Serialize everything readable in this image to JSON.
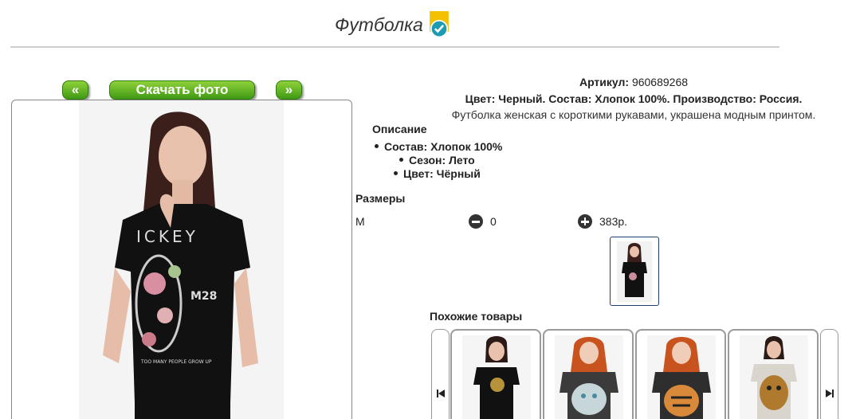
{
  "product": {
    "title": "Футболка",
    "article_label": "Артикул:",
    "article_value": "960689268",
    "meta_line": "Цвет: Черный. Состав: Хлопок 100%. Производство: Россия.",
    "short_description": "Футболка женская с короткими рукавами, украшена модным принтом."
  },
  "photo_nav": {
    "prev_label": "«",
    "download_label": "Скачать фото",
    "next_label": "»"
  },
  "description": {
    "heading": "Описание",
    "items": [
      "Состав: Хлопок 100%",
      "Сезон: Лето",
      "Цвет: Чёрный"
    ]
  },
  "sizes": {
    "heading": "Размеры",
    "rows": [
      {
        "size": "M",
        "quantity": "0",
        "price": "383р."
      }
    ]
  },
  "similar": {
    "heading": "Похожие товары"
  },
  "colors": {
    "button_green": "#5bb325",
    "badge_gold": "#f2c200",
    "badge_teal": "#1e9bb3",
    "thumb_border": "#1d3f6e"
  },
  "icons": {
    "verified": "verified-badge-icon",
    "minus": "minus-circle-icon",
    "plus": "plus-circle-icon",
    "carousel_prev": "skip-back-icon",
    "carousel_next": "skip-forward-icon"
  }
}
